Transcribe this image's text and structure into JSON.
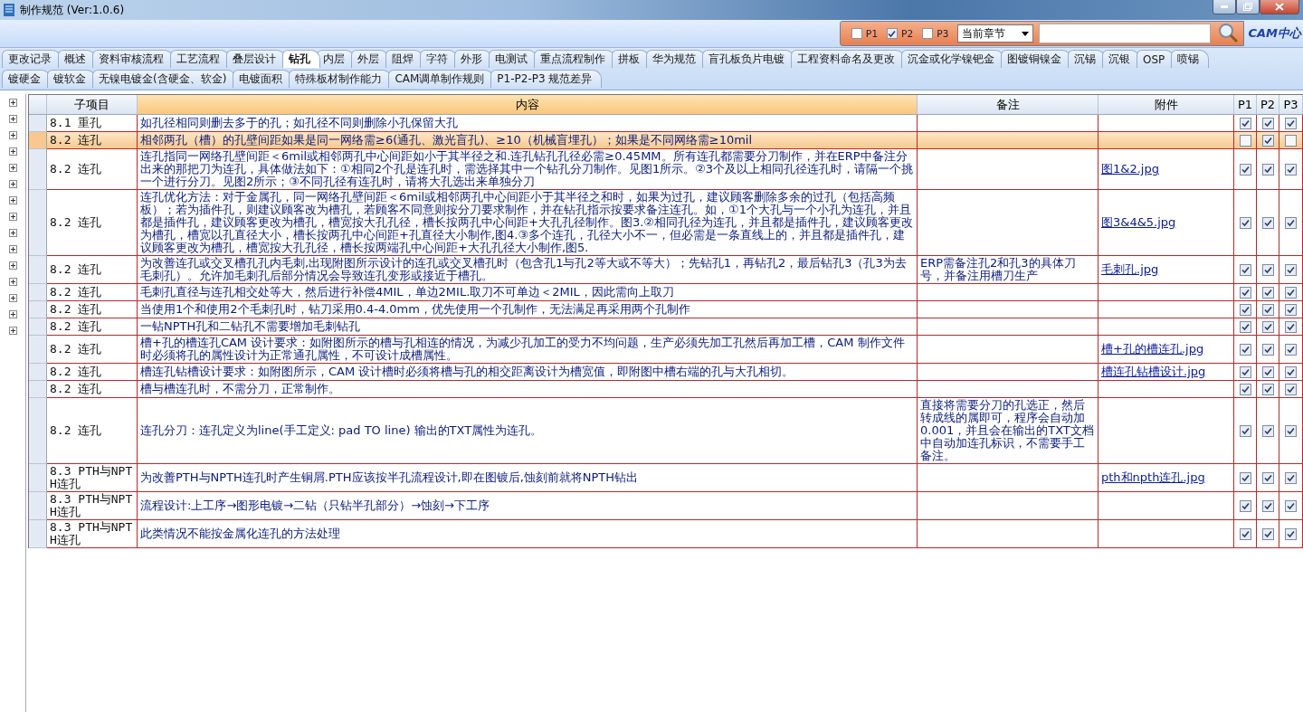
{
  "window": {
    "title": "制作规范 (Ver:1.0.6)"
  },
  "filter": {
    "options": [
      {
        "label": "P1",
        "checked": false
      },
      {
        "label": "P2",
        "checked": true
      },
      {
        "label": "P3",
        "checked": false
      }
    ],
    "scope": "当前章节",
    "logo": "CAM中心"
  },
  "tab_rows": [
    [
      {
        "label": "更改记录",
        "selected": false
      },
      {
        "label": "概述",
        "selected": false
      },
      {
        "label": "资料审核流程",
        "selected": false
      },
      {
        "label": "工艺流程",
        "selected": false
      },
      {
        "label": "叠层设计",
        "selected": false
      },
      {
        "label": "钻孔",
        "selected": true
      },
      {
        "label": "内层",
        "selected": false
      },
      {
        "label": "外层",
        "selected": false
      },
      {
        "label": "阻焊",
        "selected": false
      },
      {
        "label": "字符",
        "selected": false
      },
      {
        "label": "外形",
        "selected": false
      },
      {
        "label": "电测试",
        "selected": false
      },
      {
        "label": "重点流程制作",
        "selected": false
      },
      {
        "label": "拼板",
        "selected": false
      },
      {
        "label": "华为规范",
        "selected": false
      },
      {
        "label": "盲孔板负片电镀",
        "selected": false
      },
      {
        "label": "工程资料命名及更改",
        "selected": false
      },
      {
        "label": "沉金或化学镍钯金",
        "selected": false
      },
      {
        "label": "图镀铜镍金",
        "selected": false
      },
      {
        "label": "沉锡",
        "selected": false
      },
      {
        "label": "沉银",
        "selected": false
      },
      {
        "label": "OSP",
        "selected": false
      },
      {
        "label": "喷锡",
        "selected": false
      }
    ],
    [
      {
        "label": "镀硬金",
        "selected": false
      },
      {
        "label": "镀软金",
        "selected": false
      },
      {
        "label": "无镍电镀金(含硬金、软金)",
        "selected": false
      },
      {
        "label": "电镀面积",
        "selected": false
      },
      {
        "label": "特殊板材制作能力",
        "selected": false
      },
      {
        "label": "CAM调单制作规则",
        "selected": false
      },
      {
        "label": "P1-P2-P3 规范差异",
        "selected": false
      }
    ]
  ],
  "table": {
    "columns": [
      "子项目",
      "内容",
      "备注",
      "附件",
      "P1",
      "P2",
      "P3"
    ],
    "rows": [
      {
        "item": "8.1 重孔",
        "content": "如孔径相同则删去多于的孔；如孔径不同则删除小孔保留大孔",
        "note": "",
        "attachment": "",
        "p1": true,
        "p2": true,
        "p3": true,
        "selected": false
      },
      {
        "item": "8.2 连孔",
        "content": "相邻两孔（槽）的孔壁间距如果是同一网络需≥6(通孔、激光盲孔)、≥10（机械盲埋孔）；如果是不同网络需≥10mil",
        "note": "",
        "attachment": "",
        "p1": false,
        "p2": true,
        "p3": false,
        "selected": true
      },
      {
        "item": "8.2 连孔",
        "content": "连孔指同一网络孔壁间距＜6mil或相邻两孔中心间距如小于其半径之和.连孔钻孔孔径必需≥0.45MM。所有连孔都需要分刀制作，并在ERP中备注分出来的那把刀为连孔，具体做法如下：①相同2个孔是连孔时，需选择其中一个钻孔分刀制作。见图1所示。②3个及以上相同孔径连孔时，请隔一个挑一个进行分刀。见图2所示；③不同孔径有连孔时，请将大孔选出来单独分刀",
        "note": "",
        "attachment": "图1&2.jpg",
        "p1": true,
        "p2": true,
        "p3": true,
        "selected": false
      },
      {
        "item": "8.2 连孔",
        "content": "连孔优化方法：对于金属孔，同一网络孔壁间距＜6mil或相邻两孔中心间距小于其半径之和时，如果为过孔，建议顾客删除多余的过孔（包括高频板）；若为插件孔，则建议顾客改为槽孔，若顾客不同意则按分刀要求制作，并在钻孔指示按要求备注连孔。如，①1个大孔与一个小孔为连孔，并且都是插件孔，建议顾客更改为槽孔，槽宽按大孔孔径，槽长按两孔中心间距+大孔孔径制作。图3.②相同孔径为连孔，并且都是插件孔，建议顾客更改为槽孔，槽宽以孔直径大小，槽长按两孔中心间距+孔直径大小制作,图4.③多个连孔，孔径大小不一，但必需是一条直线上的，并且都是插件孔，建议顾客更改为槽孔，槽宽按大孔孔径，槽长按两端孔中心间距+大孔孔径大小制作,图5.",
        "note": "",
        "attachment": "图3&4&5.jpg",
        "p1": true,
        "p2": true,
        "p3": true,
        "selected": false
      },
      {
        "item": "8.2 连孔",
        "content": "为改善连孔或交叉槽孔孔内毛刺,出现附图所示设计的连孔或交叉槽孔时（包含孔1与孔2等大或不等大）；先钻孔1，再钻孔2，最后钻孔3（孔3为去毛刺孔）。允许加毛刺孔后部分情况会导致连孔变形或接近于槽孔。",
        "note": "ERP需备注孔2和孔3的具体刀号，并备注用槽刀生产",
        "attachment": "毛刺孔.jpg",
        "p1": true,
        "p2": true,
        "p3": true,
        "selected": false
      },
      {
        "item": "8.2 连孔",
        "content": "毛刺孔直径与连孔相交处等大，然后进行补偿4MIL，单边2MIL.取刀不可单边＜2MIL，因此需向上取刀",
        "note": "",
        "attachment": "",
        "p1": true,
        "p2": true,
        "p3": true,
        "selected": false
      },
      {
        "item": "8.2 连孔",
        "content": "当使用1个和使用2个毛刺孔时，钻刀采用0.4-4.0mm，优先使用一个孔制作，无法满足再采用两个孔制作",
        "note": "",
        "attachment": "",
        "p1": true,
        "p2": true,
        "p3": true,
        "selected": false
      },
      {
        "item": "8.2 连孔",
        "content": "一钻NPTH孔和二钻孔不需要增加毛刺钻孔",
        "note": "",
        "attachment": "",
        "p1": true,
        "p2": true,
        "p3": true,
        "selected": false
      },
      {
        "item": "8.2 连孔",
        "content": "槽+孔的槽连孔CAM 设计要求：如附图所示的槽与孔相连的情况，为减少孔加工的受力不均问题，生产必须先加工孔然后再加工槽，CAM 制作文件时必须将孔的属性设计为正常通孔属性，不可设计成槽属性。",
        "note": "",
        "attachment": "槽+孔的槽连孔.jpg",
        "p1": true,
        "p2": true,
        "p3": true,
        "selected": false
      },
      {
        "item": "8.2 连孔",
        "content": "槽连孔钻槽设计要求：如附图所示，CAM 设计槽时必须将槽与孔的相交距离设计为槽宽值，即附图中槽右端的孔与大孔相切。",
        "note": "",
        "attachment": "槽连孔钻槽设计.jpg",
        "p1": true,
        "p2": true,
        "p3": true,
        "selected": false
      },
      {
        "item": "8.2 连孔",
        "content": "槽与槽连孔时，不需分刀，正常制作。",
        "note": "",
        "attachment": "",
        "p1": true,
        "p2": true,
        "p3": true,
        "selected": false
      },
      {
        "item": "8.2 连孔",
        "content": "连孔分刀：连孔定义为line(手工定义: pad TO line) 输出的TXT属性为连孔。",
        "note": "直接将需要分刀的孔选正，然后转成线的属即可，程序会自动加0.001，并且会在输出的TXT文档中自动加连孔标识，不需要手工备注。",
        "attachment": "",
        "p1": true,
        "p2": true,
        "p3": true,
        "selected": false
      },
      {
        "item": "8.3 PTH与NPTH连孔",
        "content": "为改善PTH与NPTH连孔时产生铜屑.PTH应该按半孔流程设计,即在图镀后,蚀刻前就将NPTH钻出",
        "note": "",
        "attachment": "pth和npth连孔.jpg",
        "p1": true,
        "p2": true,
        "p3": true,
        "selected": false
      },
      {
        "item": "8.3 PTH与NPTH连孔",
        "content": "流程设计:上工序→图形电镀→二钻（只钻半孔部分）→蚀刻→下工序",
        "note": "",
        "attachment": "",
        "p1": true,
        "p2": true,
        "p3": true,
        "selected": false
      },
      {
        "item": "8.3 PTH与NPTH连孔",
        "content": "此类情况不能按金属化连孔的方法处理",
        "note": "",
        "attachment": "",
        "p1": true,
        "p2": true,
        "p3": true,
        "selected": false
      }
    ]
  }
}
